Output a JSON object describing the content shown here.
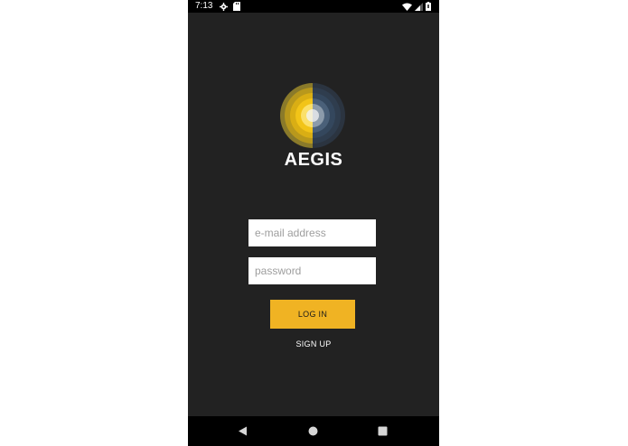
{
  "status_bar": {
    "time": "7:13",
    "icons": [
      "settings-icon",
      "sd-card-icon",
      "wifi-icon",
      "signal-icon",
      "battery-icon"
    ]
  },
  "app": {
    "name": "AEGIS",
    "logo": "aegis-logo",
    "colors": {
      "background": "#222222",
      "accent": "#f0b323",
      "logo_blue": "#2f4a63"
    }
  },
  "login_form": {
    "email_placeholder": "e-mail address",
    "email_value": "",
    "password_placeholder": "password",
    "password_value": "",
    "login_label": "LOG IN",
    "signup_label": "SIGN UP"
  },
  "nav_bar": {
    "icons": [
      "back-icon",
      "home-icon",
      "recents-icon"
    ]
  }
}
